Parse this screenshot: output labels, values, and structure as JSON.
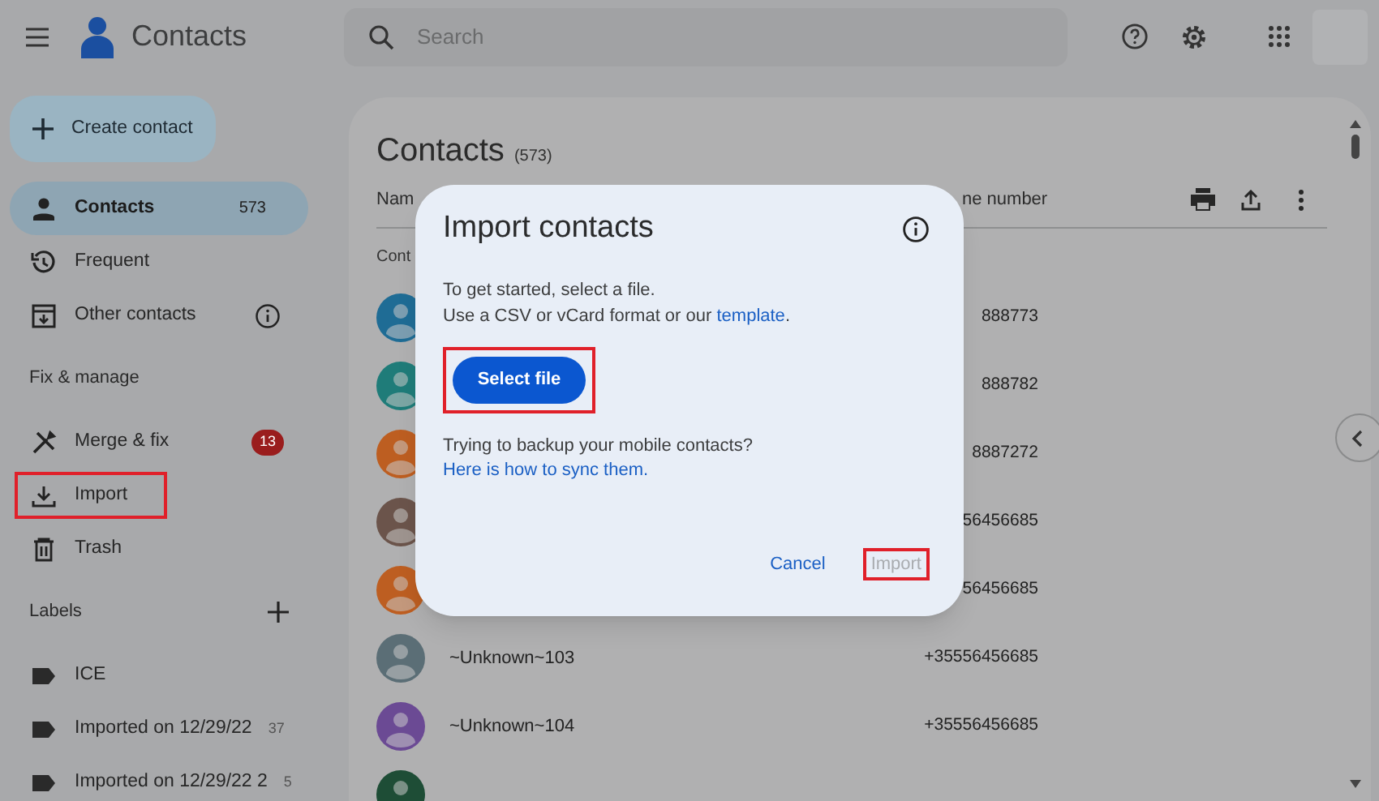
{
  "topbar": {
    "app_title": "Contacts",
    "search": {
      "placeholder": "Search"
    }
  },
  "sidebar": {
    "create_label": "Create contact",
    "items": [
      {
        "kind": "person",
        "label": "Contacts",
        "count": "573",
        "selected": true
      },
      {
        "kind": "history",
        "label": "Frequent",
        "selected": false
      },
      {
        "kind": "archive",
        "label": "Other contacts",
        "info": true,
        "selected": false
      },
      {
        "kind": "heading",
        "label": "Fix & manage"
      },
      {
        "kind": "tools",
        "label": "Merge & fix",
        "badge": "13",
        "selected": false
      },
      {
        "kind": "download",
        "label": "Import",
        "highlighted": true,
        "selected": false
      },
      {
        "kind": "trash",
        "label": "Trash",
        "selected": false
      },
      {
        "kind": "heading",
        "label": "Labels",
        "add": true
      },
      {
        "kind": "label",
        "label": "ICE",
        "selected": false
      },
      {
        "kind": "label",
        "label": "Imported on 12/29/22",
        "count": "37",
        "selected": false
      },
      {
        "kind": "label",
        "label": "Imported on 12/29/22 2",
        "count": "5",
        "selected": false
      }
    ]
  },
  "main": {
    "title": "Contacts",
    "count": "(573)",
    "columns": [
      "Nam",
      "ne number"
    ],
    "section_label": "Cont",
    "rows": [
      {
        "phone": "888773",
        "color": "#1f6c95"
      },
      {
        "phone": "888782",
        "color": "#1f7c79"
      },
      {
        "phone": "8887272",
        "color": "#bd5e21"
      },
      {
        "phone": "56456685",
        "color": "#6b544b"
      },
      {
        "phone": "56456685",
        "color": "#bd5e21"
      },
      {
        "name": "~Unknown~103",
        "phone": "+35556456685",
        "color": "#5b6e76"
      },
      {
        "name": "~Unknown~104",
        "phone": "+35556456685",
        "color": "#6b4a94"
      },
      {
        "color": "#1e4d36"
      }
    ]
  },
  "dialog": {
    "title": "Import contacts",
    "intro": "To get started, select a file.",
    "format": {
      "text": "Use a CSV or vCard format or our",
      "link": "template",
      "end": "."
    },
    "select_button": {
      "label": "Select file",
      "highlighted": true
    },
    "sync": {
      "text": "Trying to backup your mobile contacts?",
      "link": "Here is how to sync them."
    },
    "actions": [
      {
        "label": "Cancel",
        "disabled": false,
        "highlighted": false
      },
      {
        "label": "Import",
        "disabled": true,
        "highlighted": true
      }
    ]
  }
}
